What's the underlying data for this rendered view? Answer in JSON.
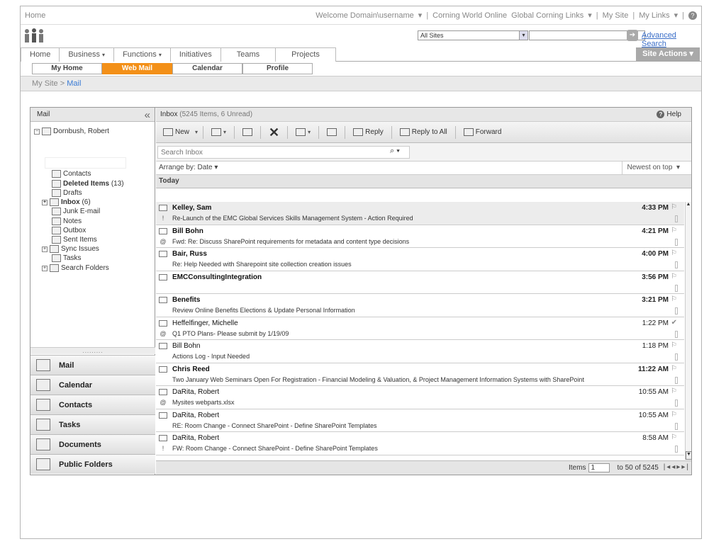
{
  "topbar": {
    "home": "Home",
    "welcome": "Welcome Domain\\username",
    "links": [
      "Corning World Online",
      "Global Corning Links",
      "My Site",
      "My Links"
    ]
  },
  "search": {
    "scope": "All Sites",
    "advanced": "Advanced Search"
  },
  "nav": {
    "tabs": [
      "Home",
      "Business",
      "Functions",
      "Initiatives",
      "Teams",
      "Projects"
    ],
    "site_actions": "Site Actions"
  },
  "subtabs": [
    "My Home",
    "Web Mail",
    "Calendar",
    "Profile"
  ],
  "breadcrumb": {
    "root": "My Site",
    "sep": " > ",
    "current": "Mail"
  },
  "left": {
    "header": "Mail",
    "root": "Dornbush, Robert",
    "folders": [
      {
        "label": "Contacts"
      },
      {
        "label": "Deleted Items",
        "count": "(13)"
      },
      {
        "label": "Drafts"
      },
      {
        "label": "Inbox",
        "count": "(6)"
      },
      {
        "label": "Junk E-mail"
      },
      {
        "label": "Notes"
      },
      {
        "label": "Outbox"
      },
      {
        "label": "Sent Items"
      },
      {
        "label": "Sync Issues"
      },
      {
        "label": "Tasks"
      },
      {
        "label": "Search Folders"
      }
    ],
    "buttons": [
      "Mail",
      "Calendar",
      "Contacts",
      "Tasks",
      "Documents",
      "Public Folders"
    ]
  },
  "inbox": {
    "title": "Inbox",
    "summary": "(5245 Items, 6 Unread)",
    "help": "Help",
    "toolbar": {
      "new": "New",
      "reply": "Reply",
      "reply_all": "Reply to All",
      "forward": "Forward"
    },
    "search_placeholder": "Search Inbox",
    "arrange": "Arrange by: Date",
    "sort": "Newest on top",
    "group": "Today",
    "messages": [
      {
        "from": "Kelley, Sam",
        "subject": "Re-Launch of the EMC Global Services Skills Management System - Action Required",
        "time": "4:33 PM",
        "unread": true,
        "mark": "!"
      },
      {
        "from": "Bill Bohn",
        "subject": "Fwd: Re: Discuss SharePoint requirements for metadata and content type decisions",
        "time": "4:21 PM",
        "unread": true,
        "mark": "@"
      },
      {
        "from": "Bair, Russ",
        "subject": "Re: Help Needed with Sharepoint site collection creation issues",
        "time": "4:00 PM",
        "unread": true,
        "mark": ""
      },
      {
        "from": "EMCConsultingIntegration",
        "subject": "",
        "time": "3:56 PM",
        "unread": true,
        "mark": ""
      },
      {
        "from": "Benefits",
        "subject": "Review Online Benefits Elections & Update Personal Information",
        "time": "3:21 PM",
        "unread": true,
        "mark": ""
      },
      {
        "from": "Heffelfinger, Michelle",
        "subject": "Q1 PTO Plans- Please submit by 1/19/09",
        "time": "1:22 PM",
        "unread": false,
        "mark": "@"
      },
      {
        "from": "Bill Bohn",
        "subject": "Actions Log - Input Needed",
        "time": "1:18 PM",
        "unread": false,
        "mark": ""
      },
      {
        "from": "Chris Reed",
        "subject": "Two January Web Seminars Open For Registration - Financial Modeling & Valuation, & Project Management Information Systems with SharePoint",
        "time": "11:22 AM",
        "unread": true,
        "mark": ""
      },
      {
        "from": "DaRita, Robert",
        "subject": "Mysites webparts.xlsx",
        "time": "10:55 AM",
        "unread": false,
        "mark": "@"
      },
      {
        "from": "DaRita, Robert",
        "subject": "RE: Room Change - Connect SharePoint - Define SharePoint Templates",
        "time": "10:55 AM",
        "unread": false,
        "mark": ""
      },
      {
        "from": "DaRita, Robert",
        "subject": "FW: Room Change - Connect SharePoint - Define SharePoint Templates",
        "time": "8:58 AM",
        "unread": false,
        "mark": "!"
      }
    ],
    "footer": {
      "items_label": "Items",
      "page": "1",
      "range": "to 50 of 5245"
    }
  }
}
